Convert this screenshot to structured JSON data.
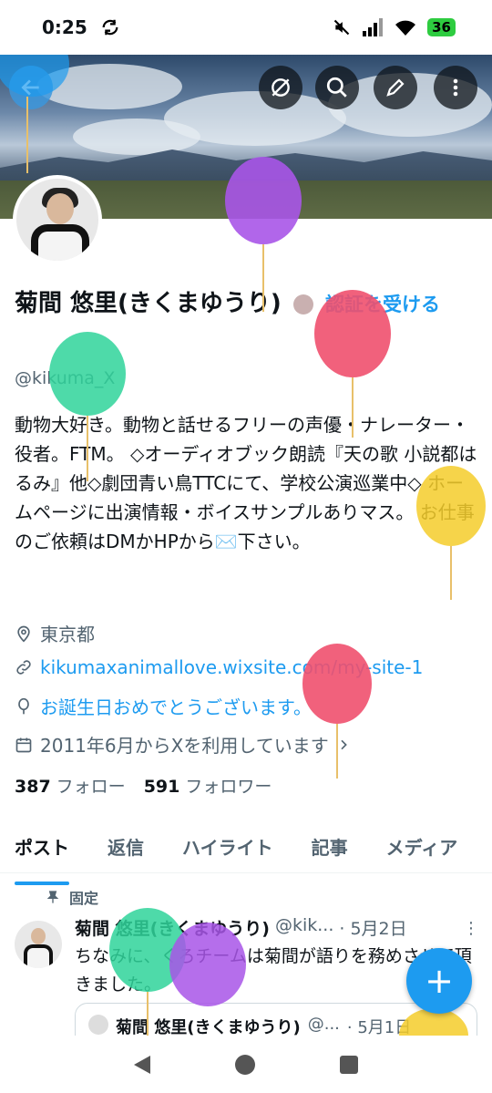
{
  "status_bar": {
    "time": "0:25",
    "battery": "36"
  },
  "profile": {
    "display_name": "菊間 悠里(きくまゆうり)",
    "verify_cta": "認証を受ける",
    "handle": "@kikuma_X",
    "bio": "動物大好き。動物と話せるフリーの声優・ナレーター・役者。FTM。 ◇オーディオブック朗読『天の歌 小説都はるみ』他◇劇団青い鳥TTCにて、学校公演巡業中◇ ホームページに出演情報・ボイスサンプルありマス。 お仕事のご依頼はDMかHPから✉️下さい。",
    "location": "東京都",
    "website": "kikumaxanimallove.wixsite.com/my-site-1",
    "birthday": "お誕生日おめでとうございます。",
    "joined": "2011年6月からXを利用しています",
    "following_count": "387",
    "following_label": "フォロー",
    "followers_count": "591",
    "followers_label": "フォロワー"
  },
  "tabs": [
    {
      "label": "ポスト"
    },
    {
      "label": "返信"
    },
    {
      "label": "ハイライト"
    },
    {
      "label": "記事"
    },
    {
      "label": "メディア"
    }
  ],
  "pinned_post": {
    "pinned_label": "固定",
    "author": "菊間 悠里(きくまゆうり)",
    "handle": "@kik...",
    "date": "· 5月2日",
    "text": "ちなみに、くろチームは菊間が語りを務めさせて頂きました。",
    "quote": {
      "author": "菊間 悠里(きくまゆうり)",
      "handle": "@...",
      "date": "· 5月1日"
    }
  },
  "fab_label": "+",
  "colors": {
    "accent": "#1d9bf0",
    "text": "#0f1419",
    "muted": "#536471"
  },
  "icons": [
    "back-arrow-icon",
    "hide-icon",
    "search-icon",
    "edit-icon",
    "more-icon",
    "location-icon",
    "link-icon",
    "balloon-icon",
    "calendar-icon",
    "pin-icon"
  ]
}
